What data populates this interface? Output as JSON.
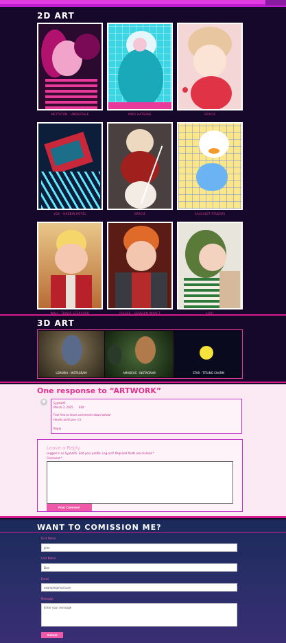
{
  "art2d": {
    "title": "2D ART",
    "cards": [
      {
        "caption": "METTATON - UNDERTALE"
      },
      {
        "caption": "MIKU HATSUNE"
      },
      {
        "caption": "GRACIE"
      },
      {
        "caption": "VOX - HAZBIN HOTEL"
      },
      {
        "caption": "GRACIE"
      },
      {
        "caption": "CALCULET STUDIOS"
      },
      {
        "caption": "WAH - TRAVIS STERFORD"
      },
      {
        "caption": "CHILDE - GENSHIN IMPACT"
      },
      {
        "caption": "LOKI"
      }
    ]
  },
  "art3d": {
    "title": "3D ART",
    "slides": [
      {
        "caption": "LEMURIA - INSTAGRAM"
      },
      {
        "caption": "AMADEUS - INSTAGRAM"
      },
      {
        "caption": "STAR - TITLING CHARM"
      }
    ]
  },
  "comments": {
    "title": "One response to “ARTWORK”",
    "author": "Sypha05",
    "date": "March 3, 2025",
    "edit": "Edit",
    "body_1": "Feel free to leave comments down below!",
    "body_2": "Hearts and Love <3",
    "reply": "Reply",
    "reply_title": "Leave a Reply",
    "logged_in": "Logged in as Sypha05. Edit your profile. Log out? Required fields are marked *",
    "comment_label": "Comment *",
    "post_button": "Post Comment"
  },
  "commission": {
    "title": "WANT TO COMISSION ME?",
    "first_label": "First Name",
    "first_value": "John",
    "last_label": "Last Name",
    "last_value": "Doe",
    "email_label": "Email",
    "email_value": "example@mail.com",
    "message_label": "Message",
    "message_placeholder": "Enter your message",
    "submit": "Submit"
  }
}
